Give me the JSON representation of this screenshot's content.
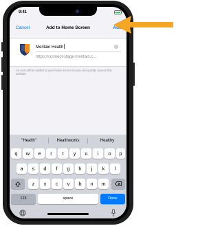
{
  "status_bar": {
    "time": "9:41"
  },
  "nav": {
    "cancel": "Cancel",
    "title": "Add to Home Screen",
    "add": "Add"
  },
  "bookmark": {
    "name": "Meritain Health",
    "url": "https://connect-stage.meritain.c...",
    "clear_icon": "x-circle-icon"
  },
  "help_text": "An icon will be added to your home screen so you can quickly access this website.",
  "keyboard": {
    "predictions": [
      "\"Health\"",
      "Healthworks",
      "Healthy"
    ],
    "row1": [
      "q",
      "w",
      "e",
      "r",
      "t",
      "y",
      "u",
      "i",
      "o",
      "p"
    ],
    "row2": [
      "a",
      "s",
      "d",
      "f",
      "g",
      "h",
      "j",
      "k",
      "l"
    ],
    "row3": [
      "z",
      "x",
      "c",
      "v",
      "b",
      "n",
      "m"
    ],
    "shift_icon": "shift-icon",
    "delete_icon": "delete-icon",
    "numbers": "123",
    "space": "space",
    "done": "Done",
    "globe_icon": "globe-icon",
    "mic_icon": "microphone-icon"
  },
  "colors": {
    "accent": "#007aff",
    "arrow": "#f5a623",
    "logo_blue": "#1f3b73",
    "logo_orange": "#f08a24"
  }
}
